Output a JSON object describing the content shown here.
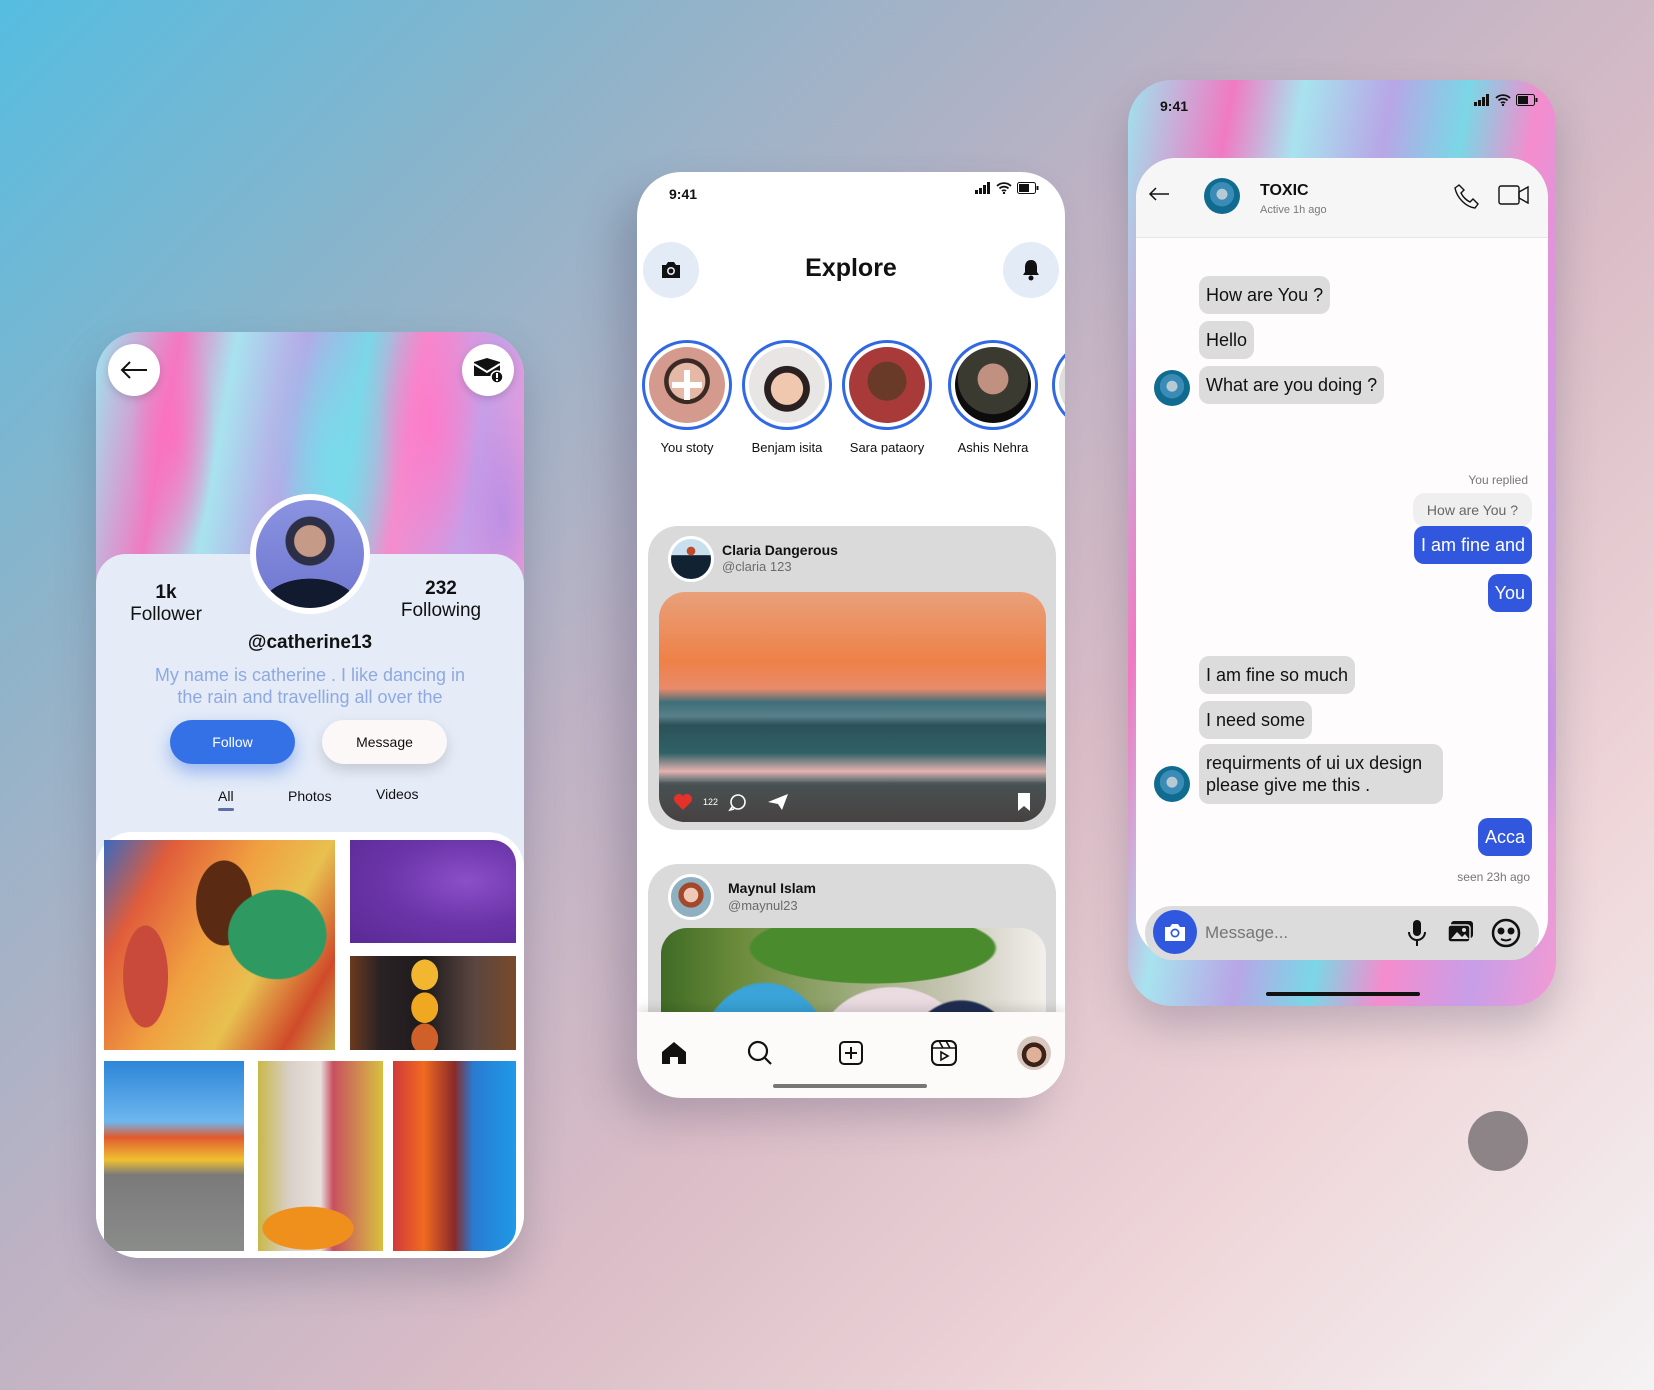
{
  "profile": {
    "followers_count": "1k",
    "followers_label": "Follower",
    "following_count": "232",
    "following_label": "Following",
    "username": "@catherine13",
    "bio": "My name is catherine . I like dancing in the rain and travelling all over the",
    "follow_label": "Follow",
    "message_label": "Message",
    "tabs": [
      {
        "label": "All",
        "active": true
      },
      {
        "label": "Photos",
        "active": false
      },
      {
        "label": "Videos",
        "active": false
      }
    ],
    "icons": {
      "back": "arrow-left-icon",
      "mail_alert": "mail-alert-icon"
    },
    "gallery": [
      "colorful-wall-windows",
      "purple-smoke",
      "autumn-leaves",
      "colorful-street",
      "townhouse-van",
      "painted-doors"
    ]
  },
  "explore": {
    "status_time": "9:41",
    "title": "Explore",
    "stories": [
      {
        "label": "You stoty",
        "is_add": true
      },
      {
        "label": "Benjam isita"
      },
      {
        "label": "Sara pataory"
      },
      {
        "label": "Ashis Nehra"
      }
    ],
    "posts": [
      {
        "name": "Claria Dangerous",
        "handle": "@claria 123",
        "likes": "122",
        "image": "sunset-sea"
      },
      {
        "name": "Maynul Islam",
        "handle": "@maynul23",
        "image": "macaw-parrot"
      }
    ],
    "nav": [
      "home-icon",
      "search-icon",
      "add-post-icon",
      "reels-icon",
      "profile-avatar"
    ]
  },
  "chat": {
    "status_time": "9:41",
    "contact_name": "TOXIC",
    "contact_status": "Active 1h ago",
    "messages_in_1": [
      "How are You ?",
      "Hello",
      "What are you doing ?"
    ],
    "replied_label": "You replied",
    "quoted": "How are You ?",
    "messages_out_1": [
      "I am fine and",
      "You"
    ],
    "messages_in_2": [
      "I am fine so much",
      "I need some",
      "requirments of ui ux design please give me this ."
    ],
    "messages_out_2": [
      "Acca"
    ],
    "seen": "seen 23h ago",
    "composer_placeholder": "Message...",
    "colors": {
      "accent": "#3157de",
      "incoming": "#dcdcdc"
    }
  }
}
